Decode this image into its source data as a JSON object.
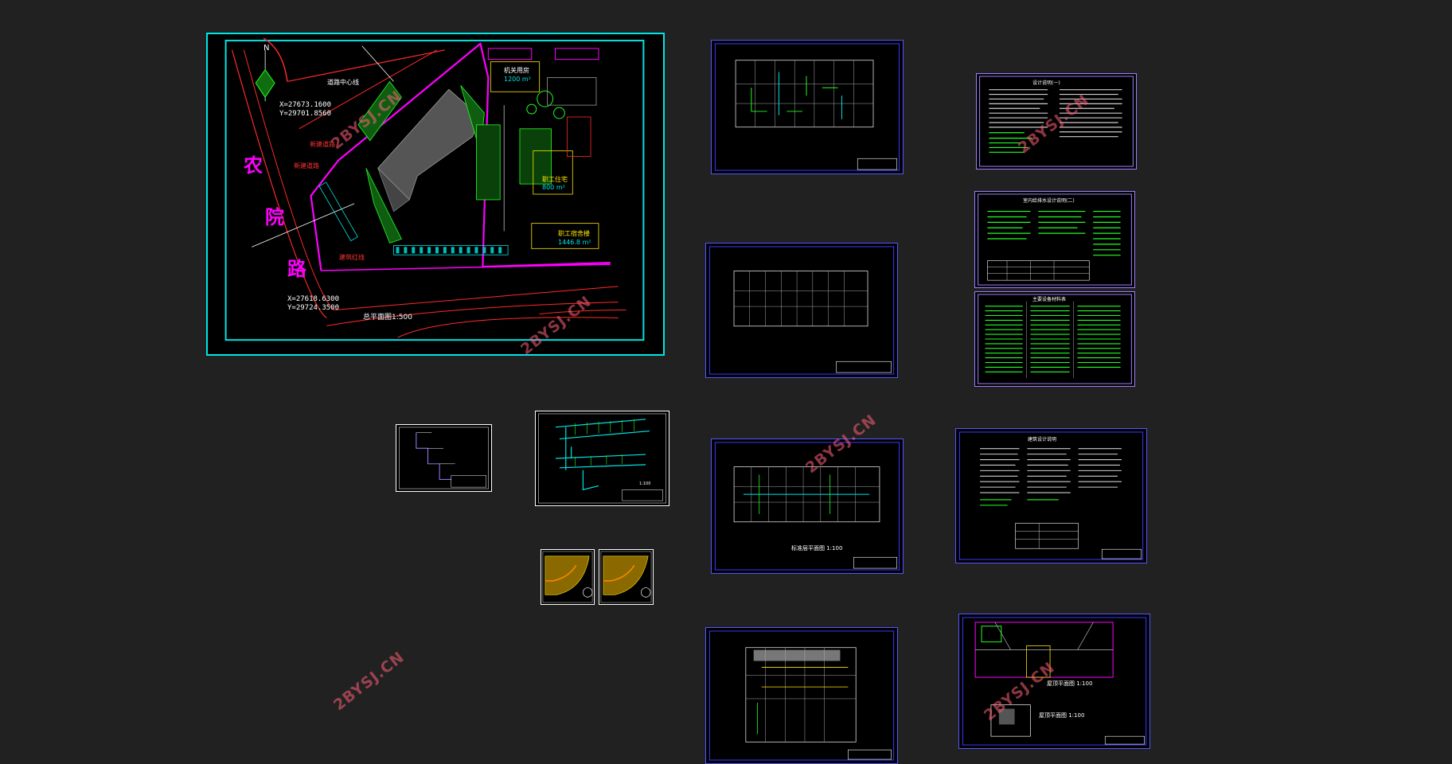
{
  "watermark": "2BYSJ.CN",
  "site_plan": {
    "north": "N",
    "road_chars": [
      "农",
      "院",
      "路"
    ],
    "coord_top_x": "X=27673.1600",
    "coord_top_y": "Y=29701.8560",
    "coord_bottom_x": "X=27618.6300",
    "coord_bottom_y": "Y=29724.3500",
    "building_top_name": "机关用房",
    "building_top_area": "1200 m²",
    "building_right_name": "职工住宅",
    "building_right_area": "800 m²",
    "building_main_name": "职工宿舍楼",
    "building_main_area": "1446.8 m²",
    "road_label_1": "新建道路",
    "road_label_2": "新建道路",
    "road_label_3": "建筑红线",
    "road_label_4": "道路中心线",
    "title": "总平面图1:500"
  },
  "sheet_titles": {
    "s2_title": "设计说明(一)",
    "s3_title": "室内给排水设计说明(二)",
    "s4_title": "主要设备材料表",
    "s5_title": "建筑设计说明",
    "floor_plan_label": "标准层平面图 1:100",
    "roof_label": "屋顶平面图 1:100",
    "roof_label2": "屋顶平面图 1:100",
    "iso_scale": "1:100"
  },
  "colors": {
    "background": "#212121",
    "sheet_bg": "#000000",
    "frame_cyan": "#00e5e5",
    "frame_blue": "#3a3aff",
    "frame_purple": "#a080ff",
    "cad_green": "#22ff22",
    "cad_magenta": "#ff00ff",
    "cad_red": "#ff2a2a",
    "cad_yellow": "#ffe600",
    "watermark": "#ff5f78"
  }
}
